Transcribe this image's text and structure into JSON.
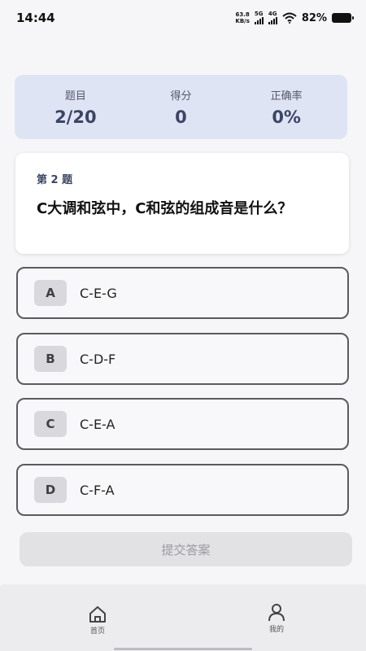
{
  "status_bar": {
    "time": "14:44",
    "net_speed_value": "63.8",
    "net_speed_unit": "KB/s",
    "sim1_label": "5G",
    "sim2_label": "4G",
    "battery_percent": "82%"
  },
  "score": {
    "question_label": "题目",
    "question_value": "2/20",
    "points_label": "得分",
    "points_value": "0",
    "accuracy_label": "正确率",
    "accuracy_value": "0%"
  },
  "question": {
    "number": "第 2 题",
    "text": "C大调和弦中，C和弦的组成音是什么？"
  },
  "options": [
    {
      "letter": "A",
      "text": "C-E-G"
    },
    {
      "letter": "B",
      "text": "C-D-F"
    },
    {
      "letter": "C",
      "text": "C-E-A"
    },
    {
      "letter": "D",
      "text": "C-F-A"
    }
  ],
  "submit_label": "提交答案",
  "nav": {
    "home_label": "首页",
    "mine_label": "我的",
    "home_icon": "home-icon",
    "mine_icon": "person-icon"
  },
  "colors": {
    "score_card_bg": "#dfe4f5",
    "accent_text": "#3b4563"
  }
}
